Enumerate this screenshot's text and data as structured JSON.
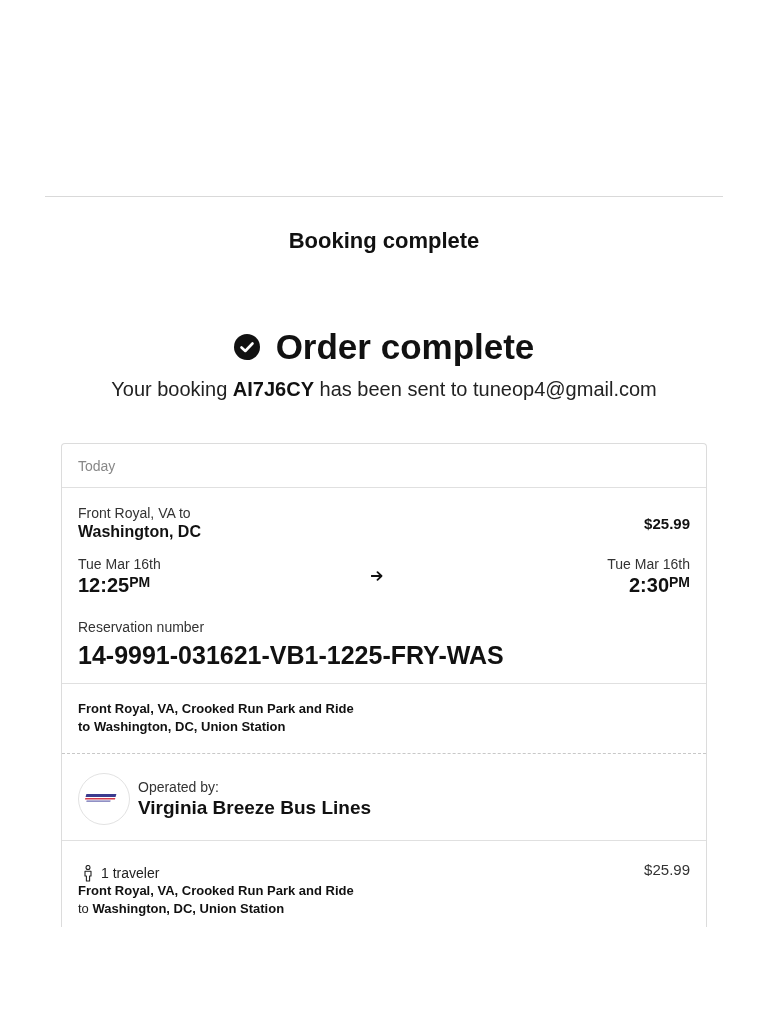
{
  "header": {
    "title": "Booking complete"
  },
  "confirmation": {
    "title": "Order complete",
    "message": "Your booking **AI7J6CY** has been sent to tuneop4@gmail.com"
  },
  "trip": {
    "day_label": "Today",
    "origin": "Front Royal, VA to",
    "destination": "Washington, DC",
    "price": "$25.99",
    "departure": {
      "date": "Tue Mar 16th",
      "time": "12:25$^{PM}$"
    },
    "arrival": {
      "date": "Tue Mar 16th",
      "time": "2:30$^{PM}$"
    },
    "reservation": {
      "label": "Reservation number",
      "number": "14-9991-031621-VB1-1225-FRY-WAS"
    },
    "stops": {
      "from": "Front Royal, VA, Crooked Run Park and Ride",
      "to": "to Washington, DC, Union Station"
    },
    "operator": {
      "label": "Operated by:",
      "name": "Virginia Breeze Bus Lines"
    },
    "travelers": {
      "count": "1 traveler",
      "price": "$25.99",
      "from": "Front Royal, VA, Crooked Run Park and Ride",
      "to": "to **Washington, DC, Union Station**"
    }
  }
}
